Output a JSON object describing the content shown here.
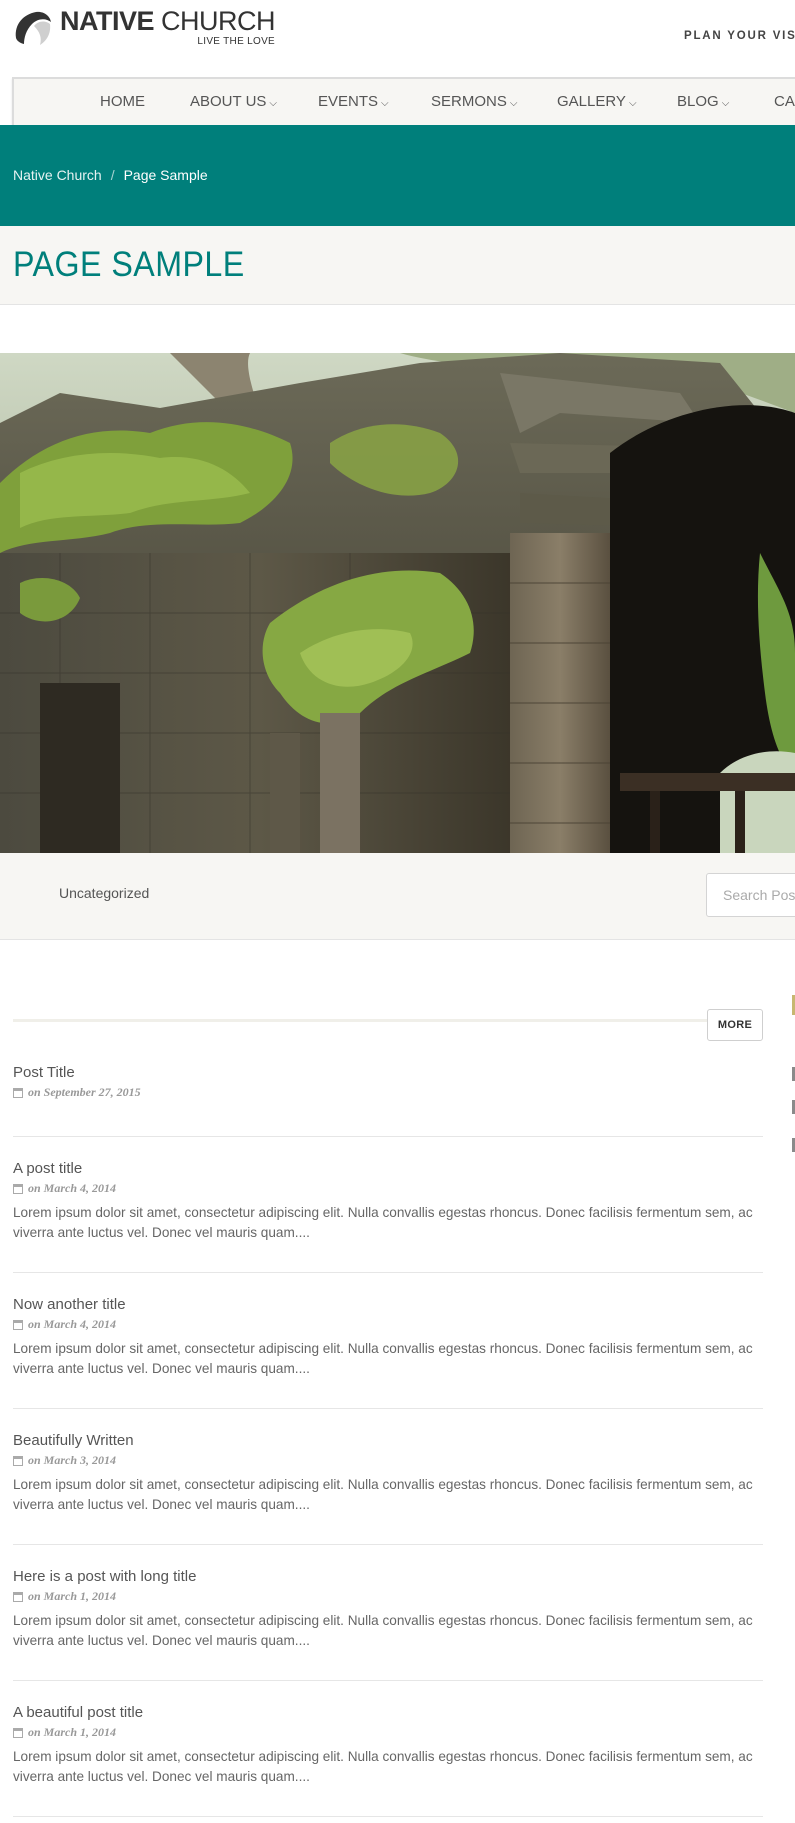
{
  "header": {
    "brand_bold": "NATIVE",
    "brand_light": " CHURCH",
    "tagline": "LIVE THE LOVE",
    "plan_link": "PLAN YOUR VISIT"
  },
  "nav": {
    "items": [
      {
        "label": "HOME",
        "has_dropdown": false
      },
      {
        "label": "ABOUT US",
        "has_dropdown": true
      },
      {
        "label": "EVENTS",
        "has_dropdown": true
      },
      {
        "label": "SERMONS",
        "has_dropdown": true
      },
      {
        "label": "GALLERY",
        "has_dropdown": true
      },
      {
        "label": "BLOG",
        "has_dropdown": true
      },
      {
        "label": "CAU",
        "has_dropdown": false
      }
    ],
    "chevron": "⌵"
  },
  "breadcrumb": {
    "home": "Native Church",
    "separator": "/",
    "current": "Page Sample"
  },
  "page": {
    "title": "PAGE SAMPLE"
  },
  "filter": {
    "category": "Uncategorized",
    "search_placeholder": "Search Pos"
  },
  "content": {
    "more_label": "MORE",
    "posts": [
      {
        "title": "Post Title",
        "date": "on September 27, 2015",
        "excerpt": ""
      },
      {
        "title": "A post title",
        "date": "on March 4, 2014",
        "excerpt": "Lorem ipsum dolor sit amet, consectetur adipiscing elit. Nulla convallis egestas rhoncus. Donec facilisis fermentum sem, ac viverra ante luctus vel. Donec vel mauris quam...."
      },
      {
        "title": "Now another title",
        "date": "on March 4, 2014",
        "excerpt": "Lorem ipsum dolor sit amet, consectetur adipiscing elit. Nulla convallis egestas rhoncus. Donec facilisis fermentum sem, ac viverra ante luctus vel. Donec vel mauris quam...."
      },
      {
        "title": "Beautifully Written",
        "date": "on March 3, 2014",
        "excerpt": "Lorem ipsum dolor sit amet, consectetur adipiscing elit. Nulla convallis egestas rhoncus. Donec facilisis fermentum sem, ac viverra ante luctus vel. Donec vel mauris quam...."
      },
      {
        "title": "Here is a post with long title",
        "date": "on March 1, 2014",
        "excerpt": "Lorem ipsum dolor sit amet, consectetur adipiscing elit. Nulla convallis egestas rhoncus. Donec facilisis fermentum sem, ac viverra ante luctus vel. Donec vel mauris quam...."
      },
      {
        "title": "A beautiful post title",
        "date": "on March 1, 2014",
        "excerpt": "Lorem ipsum dolor sit amet, consectetur adipiscing elit. Nulla convallis egestas rhoncus. Donec facilisis fermentum sem, ac viverra ante luctus vel. Donec vel mauris quam...."
      }
    ]
  },
  "colors": {
    "accent": "#007f7b",
    "band": "#f7f6f3",
    "text": "#666666"
  },
  "icons": [
    "logo-mark-icon",
    "calendar-icon",
    "chevron-down-icon"
  ]
}
